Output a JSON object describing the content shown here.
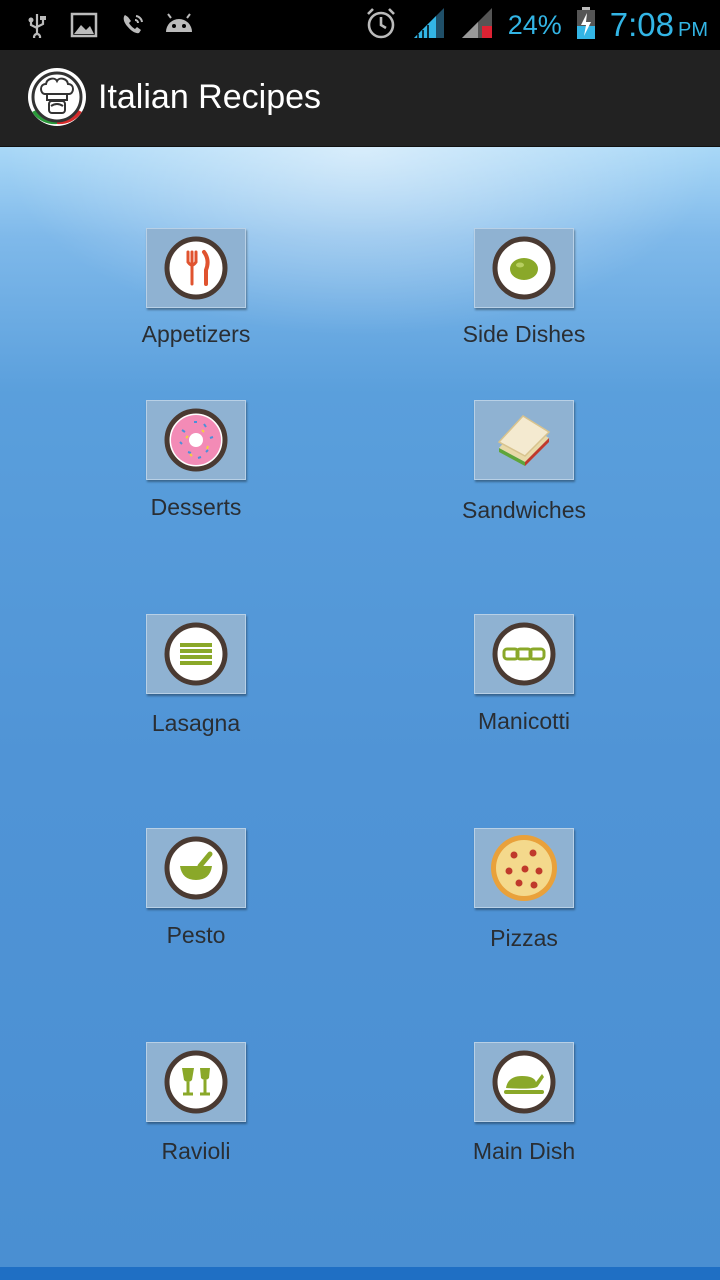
{
  "status_bar": {
    "battery_percent": "24%",
    "time": "7:08",
    "ampm": "PM",
    "icons": [
      "usb-icon",
      "gallery-icon",
      "phone-icon",
      "android-icon",
      "alarm-icon",
      "wifi-signal-icon",
      "cell-signal-icon",
      "battery-charging-icon"
    ]
  },
  "app_bar": {
    "title": "Italian Recipes",
    "logo": "chef-logo-icon"
  },
  "colors": {
    "accent": "#33b5e5",
    "ring": "#4a3a32",
    "green": "#8aa829",
    "red": "#e0532f"
  },
  "categories": [
    {
      "label": "Appetizers",
      "icon": "fork-knife-icon"
    },
    {
      "label": "Side Dishes",
      "icon": "olive-icon"
    },
    {
      "label": "Desserts",
      "icon": "donut-icon"
    },
    {
      "label": "Sandwiches",
      "icon": "sandwich-icon"
    },
    {
      "label": "Lasagna",
      "icon": "lasagna-icon"
    },
    {
      "label": "Manicotti",
      "icon": "manicotti-icon"
    },
    {
      "label": "Pesto",
      "icon": "mortar-bowl-icon"
    },
    {
      "label": "Pizzas",
      "icon": "pizza-icon"
    },
    {
      "label": "Ravioli",
      "icon": "glasses-icon"
    },
    {
      "label": "Main Dish",
      "icon": "roast-chicken-icon"
    }
  ]
}
